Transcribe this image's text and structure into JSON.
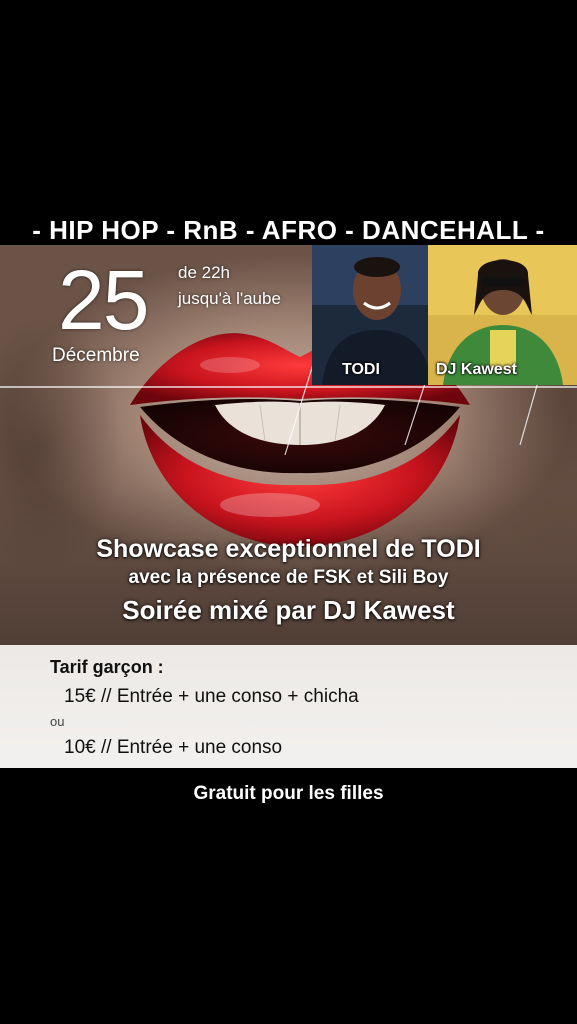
{
  "genres": "- HIP HOP - RnB - AFRO - DANCEHALL -",
  "date": {
    "day": "25",
    "month": "Décembre"
  },
  "time": {
    "from": "de 22h",
    "to": "jusqu'à l'aube"
  },
  "artists": [
    {
      "name": "TODI"
    },
    {
      "name": "DJ Kawest"
    }
  ],
  "headline": {
    "line1": "Showcase exceptionnel de TODI",
    "line2": "avec la présence de FSK et Sili Boy",
    "line3": "Soirée mixé par DJ Kawest"
  },
  "pricing": {
    "label": "Tarif garçon :",
    "option1": "15€ // Entrée + une conso + chicha",
    "separator": "ou",
    "option2": "10€ // Entrée + une conso"
  },
  "footer": "Gratuit pour les filles",
  "colors": {
    "lips": "#c8141e",
    "price_band": "#eeebe8",
    "background": "#000000"
  }
}
